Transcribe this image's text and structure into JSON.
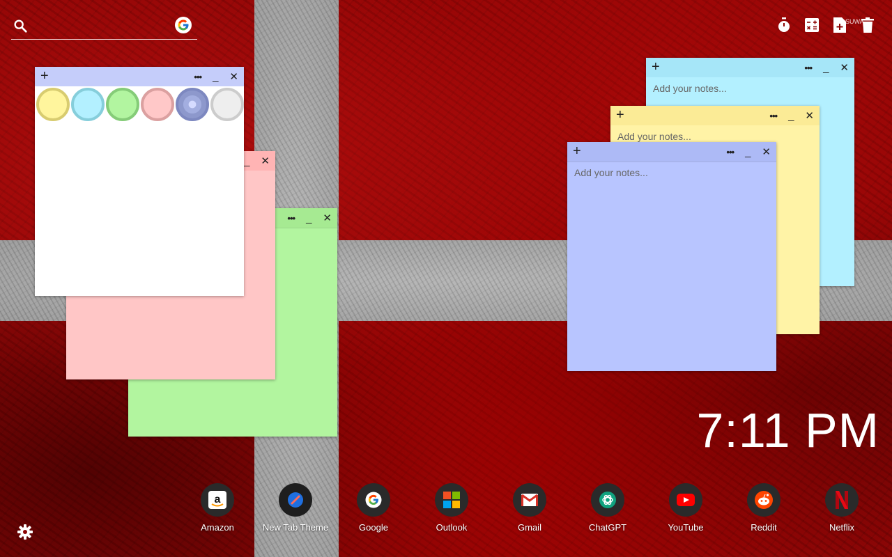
{
  "search": {
    "placeholder": "",
    "value": ""
  },
  "tools": {
    "items": [
      {
        "name": "timer",
        "icon": "stopwatch-icon"
      },
      {
        "name": "calculator",
        "icon": "calculator-icon"
      },
      {
        "name": "new-note",
        "icon": "new-note-icon"
      },
      {
        "name": "trash",
        "icon": "trash-icon"
      }
    ],
    "tooltip": "SUWA..."
  },
  "notes": {
    "placeholder": "Add your notes...",
    "palette": {
      "colors": [
        "#fff59d",
        "#b3f0ff",
        "#b2f5a0",
        "#ffc8c8",
        "#a3aee0",
        "#eeeeee"
      ],
      "borders": [
        "#d8cc70",
        "#86cedb",
        "#85cc78",
        "#dba0a0",
        "#7d88c0",
        "#cccccc"
      ]
    },
    "white": {
      "color": "#ffffff",
      "bar": "#c5cdfa"
    },
    "pink": {
      "color": "#ffc6c6",
      "bar": "#ffb4b4"
    },
    "green": {
      "color": "#b2f59f",
      "bar": "#a6ea92"
    },
    "cyan": {
      "color": "#b3f0ff",
      "bar": "#a6e6f8"
    },
    "yellow": {
      "color": "#fff3a6",
      "bar": "#fbeb96"
    },
    "blue": {
      "color": "#b8c5ff",
      "bar": "#adbaf6"
    }
  },
  "clock": {
    "time": "7:11 PM"
  },
  "dock": [
    {
      "label": "Amazon",
      "icon": "amazon-icon"
    },
    {
      "label": "New Tab Theme",
      "icon": "new-tab-theme-icon"
    },
    {
      "label": "Google",
      "icon": "google-icon"
    },
    {
      "label": "Outlook",
      "icon": "outlook-icon"
    },
    {
      "label": "Gmail",
      "icon": "gmail-icon"
    },
    {
      "label": "ChatGPT",
      "icon": "chatgpt-icon"
    },
    {
      "label": "YouTube",
      "icon": "youtube-icon"
    },
    {
      "label": "Reddit",
      "icon": "reddit-icon"
    },
    {
      "label": "Netflix",
      "icon": "netflix-icon"
    }
  ]
}
